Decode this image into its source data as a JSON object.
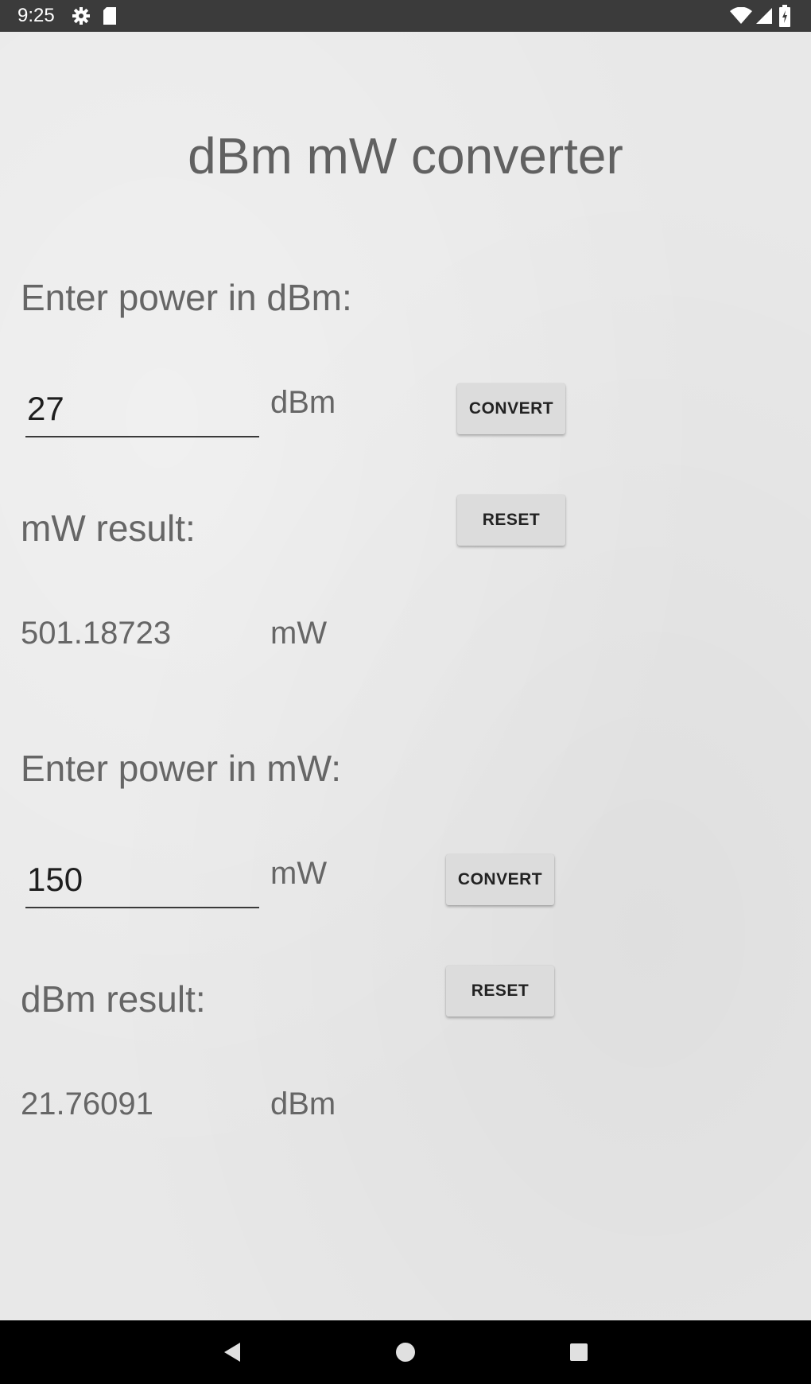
{
  "status_bar": {
    "time": "9:25",
    "icons_left": [
      "gear-icon",
      "sd-card-icon"
    ],
    "icons_right": [
      "wifi-icon",
      "signal-icon",
      "battery-icon"
    ]
  },
  "app": {
    "title": "dBm mW converter",
    "dbm_to_mw": {
      "prompt": "Enter power in dBm:",
      "input_value": "27",
      "input_unit": "dBm",
      "convert_label": "CONVERT",
      "reset_label": "RESET",
      "result_label": "mW result:",
      "result_value": "501.18723",
      "result_unit": "mW"
    },
    "mw_to_dbm": {
      "prompt": "Enter power in mW:",
      "input_value": "150",
      "input_unit": "mW",
      "convert_label": "CONVERT",
      "reset_label": "RESET",
      "result_label": "dBm result:",
      "result_value": "21.76091",
      "result_unit": "dBm"
    }
  },
  "nav_bar": {
    "buttons": [
      "back-icon",
      "home-icon",
      "recents-icon"
    ]
  },
  "colors": {
    "background": "#e8e8e8",
    "text": "#666666",
    "button": "#dcdcdc",
    "status_bar": "#3b3b3b",
    "nav_bar": "#000000"
  }
}
